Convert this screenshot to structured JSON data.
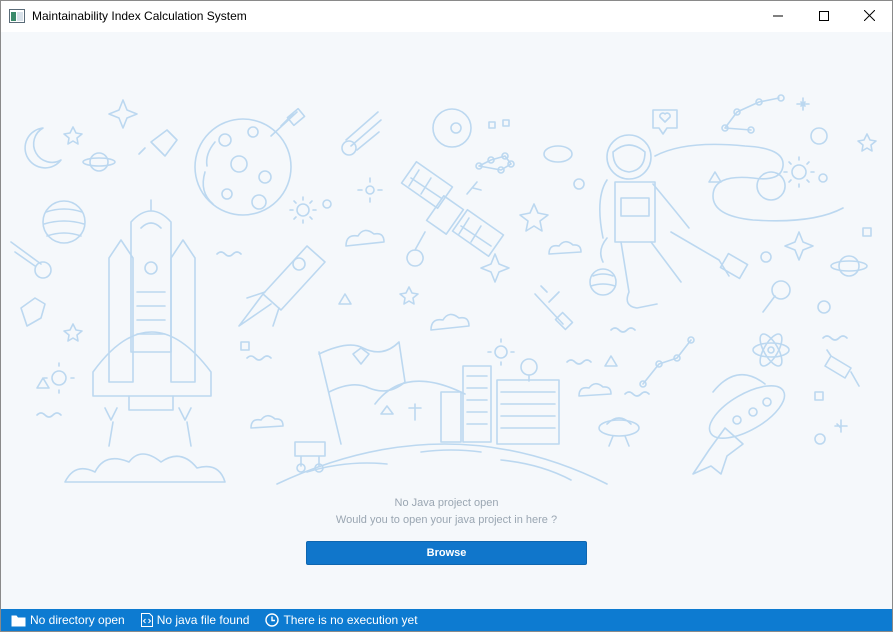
{
  "window": {
    "title": "Maintainability Index Calculation System",
    "icon": "app-window-icon",
    "controls": {
      "minimize": "minimize-icon",
      "maximize": "maximize-icon",
      "close": "close-icon"
    }
  },
  "main": {
    "empty_state": {
      "line1": "No Java project open",
      "line2": "Would you to open your java project in here ?",
      "illustration": "space-scene-illustration"
    },
    "browse_label": "Browse"
  },
  "statusbar": {
    "directory": {
      "icon": "folder-icon",
      "label": "No directory open"
    },
    "java_file": {
      "icon": "code-file-icon",
      "label": "No java file found"
    },
    "execution": {
      "icon": "clock-icon",
      "label": "There is no execution yet"
    }
  },
  "colors": {
    "accent": "#1076cb",
    "statusbar": "#0d7bd1",
    "illustration_stroke": "#bcd8f0",
    "background": "#f5f8fb"
  }
}
